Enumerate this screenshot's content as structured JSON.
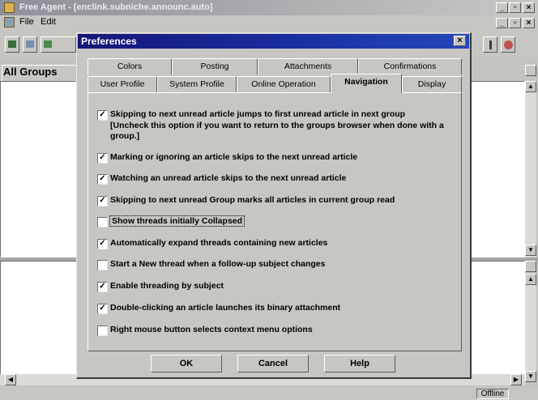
{
  "app": {
    "title": "Free Agent - [enclink.subniche.announc.auto]",
    "menu": [
      "File",
      "Edit"
    ],
    "window_buttons": [
      "_",
      "▫",
      "×"
    ],
    "groups_pane_title": "All Groups",
    "status": "Offline"
  },
  "dialog": {
    "title": "Preferences",
    "close_label": "×",
    "tabs_back": [
      "Colors",
      "Posting",
      "Attachments",
      "Confirmations"
    ],
    "tabs_front": [
      "User Profile",
      "System Profile",
      "Online Operation",
      "Navigation",
      "Display"
    ],
    "active_tab": "Navigation",
    "options": [
      {
        "label": "Skipping to next unread article jumps to first unread article in next group",
        "checked": true
      },
      {
        "label": "Marking or ignoring an article skips to the next unread article",
        "checked": true
      },
      {
        "label": "Watching an unread article skips to the next unread article",
        "checked": true
      },
      {
        "label": "Skipping to next unread Group marks all articles in current group read",
        "checked": true
      },
      {
        "label": "Show threads initially Collapsed",
        "checked": false
      },
      {
        "label": "Automatically expand threads containing new articles",
        "checked": true
      },
      {
        "label": "Start a New thread when a follow-up subject changes",
        "checked": false
      },
      {
        "label": "Enable threading by subject",
        "checked": true
      },
      {
        "label": "Double-clicking an article launches its binary attachment",
        "checked": true
      },
      {
        "label": "Right mouse button selects context menu options",
        "checked": false
      }
    ],
    "note": "[Uncheck this option if you want to return to the groups browser when done with a group.]",
    "buttons": {
      "ok": "OK",
      "cancel": "Cancel",
      "help": "Help"
    }
  }
}
